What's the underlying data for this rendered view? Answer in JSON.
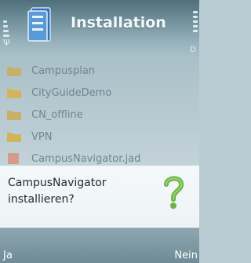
{
  "header": {
    "title": "Installation",
    "signal_glyph": "Ψ",
    "right_partial": "D"
  },
  "list": {
    "items": [
      {
        "label": "Campusplan",
        "icon": "folder-icon",
        "color": "#c9b06a"
      },
      {
        "label": "CityGuideDemo",
        "icon": "folder-icon",
        "color": "#d4b45a"
      },
      {
        "label": "CN_offline",
        "icon": "folder-icon",
        "color": "#c9b06a"
      },
      {
        "label": "VPN",
        "icon": "folder-icon",
        "color": "#d4b45a"
      },
      {
        "label": "CampusNavigator.jad",
        "icon": "file-icon",
        "color": "#d69a8a"
      }
    ]
  },
  "dialog": {
    "line1": "CampusNavigator",
    "line2": "installieren?",
    "icon": "question-mark-icon",
    "icon_color": "#6db34a"
  },
  "softkeys": {
    "left": "Ja",
    "right": "Nein"
  }
}
